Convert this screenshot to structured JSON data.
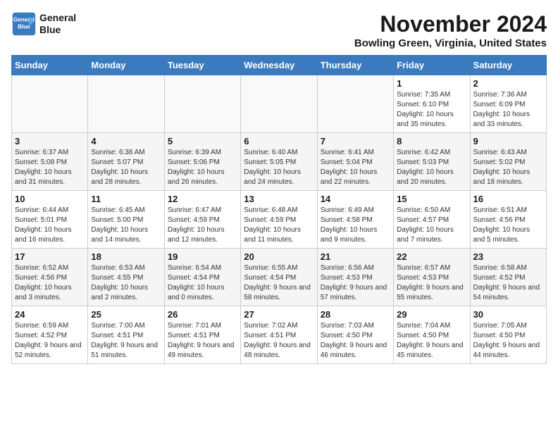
{
  "header": {
    "logo_line1": "General",
    "logo_line2": "Blue",
    "month": "November 2024",
    "location": "Bowling Green, Virginia, United States"
  },
  "weekdays": [
    "Sunday",
    "Monday",
    "Tuesday",
    "Wednesday",
    "Thursday",
    "Friday",
    "Saturday"
  ],
  "weeks": [
    [
      {
        "day": "",
        "info": ""
      },
      {
        "day": "",
        "info": ""
      },
      {
        "day": "",
        "info": ""
      },
      {
        "day": "",
        "info": ""
      },
      {
        "day": "",
        "info": ""
      },
      {
        "day": "1",
        "info": "Sunrise: 7:35 AM\nSunset: 6:10 PM\nDaylight: 10 hours and 35 minutes."
      },
      {
        "day": "2",
        "info": "Sunrise: 7:36 AM\nSunset: 6:09 PM\nDaylight: 10 hours and 33 minutes."
      }
    ],
    [
      {
        "day": "3",
        "info": "Sunrise: 6:37 AM\nSunset: 5:08 PM\nDaylight: 10 hours and 31 minutes."
      },
      {
        "day": "4",
        "info": "Sunrise: 6:38 AM\nSunset: 5:07 PM\nDaylight: 10 hours and 28 minutes."
      },
      {
        "day": "5",
        "info": "Sunrise: 6:39 AM\nSunset: 5:06 PM\nDaylight: 10 hours and 26 minutes."
      },
      {
        "day": "6",
        "info": "Sunrise: 6:40 AM\nSunset: 5:05 PM\nDaylight: 10 hours and 24 minutes."
      },
      {
        "day": "7",
        "info": "Sunrise: 6:41 AM\nSunset: 5:04 PM\nDaylight: 10 hours and 22 minutes."
      },
      {
        "day": "8",
        "info": "Sunrise: 6:42 AM\nSunset: 5:03 PM\nDaylight: 10 hours and 20 minutes."
      },
      {
        "day": "9",
        "info": "Sunrise: 6:43 AM\nSunset: 5:02 PM\nDaylight: 10 hours and 18 minutes."
      }
    ],
    [
      {
        "day": "10",
        "info": "Sunrise: 6:44 AM\nSunset: 5:01 PM\nDaylight: 10 hours and 16 minutes."
      },
      {
        "day": "11",
        "info": "Sunrise: 6:45 AM\nSunset: 5:00 PM\nDaylight: 10 hours and 14 minutes."
      },
      {
        "day": "12",
        "info": "Sunrise: 6:47 AM\nSunset: 4:59 PM\nDaylight: 10 hours and 12 minutes."
      },
      {
        "day": "13",
        "info": "Sunrise: 6:48 AM\nSunset: 4:59 PM\nDaylight: 10 hours and 11 minutes."
      },
      {
        "day": "14",
        "info": "Sunrise: 6:49 AM\nSunset: 4:58 PM\nDaylight: 10 hours and 9 minutes."
      },
      {
        "day": "15",
        "info": "Sunrise: 6:50 AM\nSunset: 4:57 PM\nDaylight: 10 hours and 7 minutes."
      },
      {
        "day": "16",
        "info": "Sunrise: 6:51 AM\nSunset: 4:56 PM\nDaylight: 10 hours and 5 minutes."
      }
    ],
    [
      {
        "day": "17",
        "info": "Sunrise: 6:52 AM\nSunset: 4:56 PM\nDaylight: 10 hours and 3 minutes."
      },
      {
        "day": "18",
        "info": "Sunrise: 6:53 AM\nSunset: 4:55 PM\nDaylight: 10 hours and 2 minutes."
      },
      {
        "day": "19",
        "info": "Sunrise: 6:54 AM\nSunset: 4:54 PM\nDaylight: 10 hours and 0 minutes."
      },
      {
        "day": "20",
        "info": "Sunrise: 6:55 AM\nSunset: 4:54 PM\nDaylight: 9 hours and 58 minutes."
      },
      {
        "day": "21",
        "info": "Sunrise: 6:56 AM\nSunset: 4:53 PM\nDaylight: 9 hours and 57 minutes."
      },
      {
        "day": "22",
        "info": "Sunrise: 6:57 AM\nSunset: 4:53 PM\nDaylight: 9 hours and 55 minutes."
      },
      {
        "day": "23",
        "info": "Sunrise: 6:58 AM\nSunset: 4:52 PM\nDaylight: 9 hours and 54 minutes."
      }
    ],
    [
      {
        "day": "24",
        "info": "Sunrise: 6:59 AM\nSunset: 4:52 PM\nDaylight: 9 hours and 52 minutes."
      },
      {
        "day": "25",
        "info": "Sunrise: 7:00 AM\nSunset: 4:51 PM\nDaylight: 9 hours and 51 minutes."
      },
      {
        "day": "26",
        "info": "Sunrise: 7:01 AM\nSunset: 4:51 PM\nDaylight: 9 hours and 49 minutes."
      },
      {
        "day": "27",
        "info": "Sunrise: 7:02 AM\nSunset: 4:51 PM\nDaylight: 9 hours and 48 minutes."
      },
      {
        "day": "28",
        "info": "Sunrise: 7:03 AM\nSunset: 4:50 PM\nDaylight: 9 hours and 46 minutes."
      },
      {
        "day": "29",
        "info": "Sunrise: 7:04 AM\nSunset: 4:50 PM\nDaylight: 9 hours and 45 minutes."
      },
      {
        "day": "30",
        "info": "Sunrise: 7:05 AM\nSunset: 4:50 PM\nDaylight: 9 hours and 44 minutes."
      }
    ]
  ]
}
